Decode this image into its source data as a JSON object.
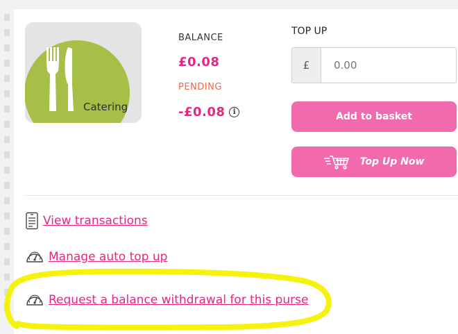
{
  "purse": {
    "tile_label": "Catering",
    "tile_icon": "fork-knife-icon",
    "balance_label": "BALANCE",
    "balance_value": "£0.08",
    "pending_label": "PENDING",
    "pending_value": "-£0.08",
    "info_symbol": "i"
  },
  "topup": {
    "label": "TOP UP",
    "currency": "£",
    "amount_placeholder": "0.00",
    "add_to_basket_label": "Add to basket",
    "top_up_now_label": "Top Up Now"
  },
  "links": [
    {
      "label": "View transactions",
      "icon": "receipt-icon"
    },
    {
      "label": "Manage auto top up",
      "icon": "gauge-icon"
    },
    {
      "label": "Request a balance withdrawal for this purse",
      "icon": "gauge-icon"
    }
  ],
  "colors": {
    "accent_pink": "#e8267f",
    "button_pink": "#f26aae",
    "pending_orange": "#f26744",
    "tile_green": "#a6bf47",
    "highlight_yellow": "#f6f000"
  }
}
